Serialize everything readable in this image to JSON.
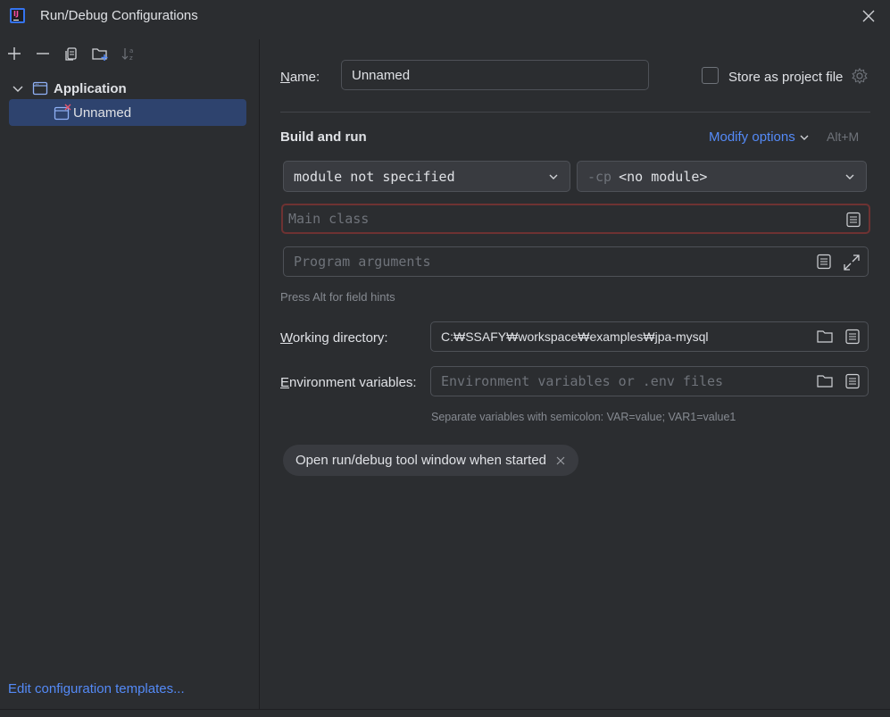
{
  "window": {
    "title": "Run/Debug Configurations",
    "app_icon_text": "IJ"
  },
  "sidebar": {
    "toolbar": [
      "add-icon",
      "remove-icon",
      "copy-icon",
      "new-folder-icon",
      "sort-icon"
    ],
    "tree": {
      "group_label": "Application",
      "item_label": "Unnamed"
    },
    "edit_templates_label": "Edit configuration templates..."
  },
  "form": {
    "name_label": "Name:",
    "name_value": "Unnamed",
    "store_label": "Store as project file",
    "section_title": "Build and run",
    "modify_options_label": "Modify options",
    "modify_shortcut": "Alt+M",
    "module_value": "module not specified",
    "cp_prefix": "-cp",
    "cp_value": "<no module>",
    "main_class_placeholder": "Main class",
    "program_args_placeholder": "Program arguments",
    "field_hint": "Press Alt for field hints",
    "working_dir_label": "Working directory:",
    "working_dir_value": "C:₩SSAFY₩workspace₩examples₩jpa-mysql",
    "env_label": "Environment variables:",
    "env_placeholder": "Environment variables or .env files",
    "env_hint": "Separate variables with semicolon: VAR=value; VAR1=value1",
    "chip_label": "Open run/debug tool window when started"
  },
  "colors": {
    "background": "#2b2d30",
    "selection": "#2e436e",
    "link": "#548af7",
    "error_border": "#6e3232"
  }
}
